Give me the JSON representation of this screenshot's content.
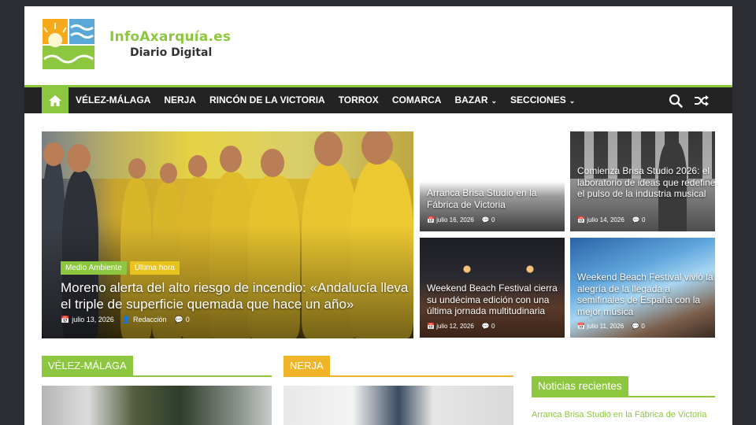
{
  "site": {
    "name": "InfoAxarquía.es",
    "tagline": "Diario Digital"
  },
  "colors": {
    "accent": "#8dc63f",
    "nav_bg": "#232323",
    "tag_yellow": "#e8c21d",
    "nerja": "#f0b429"
  },
  "nav": {
    "home_icon": "home-icon",
    "items": [
      {
        "label": "VÉLEZ-MÁLAGA"
      },
      {
        "label": "NERJA"
      },
      {
        "label": "RINCÓN DE LA VICTORIA"
      },
      {
        "label": "TORROX"
      },
      {
        "label": "COMARCA"
      },
      {
        "label": "BAZAR",
        "dropdown": true
      },
      {
        "label": "SECCIONES",
        "dropdown": true
      }
    ],
    "search_icon": "search-icon",
    "random_icon": "shuffle-icon"
  },
  "featured": {
    "main": {
      "tags": [
        "Medio Ambiente",
        "Última hora"
      ],
      "title": "Moreno alerta del alto riesgo de incendio: «Andalucía lleva el triple de superficie quemada que hace un año»",
      "date": "julio 13, 2026",
      "author": "Redacción",
      "comments": "0"
    },
    "side": [
      {
        "title": "Arranca Brisa Studio en la Fábrica de Victoria",
        "date": "julio 16, 2026",
        "comments": "0"
      },
      {
        "title": "Comienza Brisa Studio 2026: el laboratorio de ideas que redefine el pulso de la industria musical",
        "date": "julio 14, 2026",
        "comments": "0"
      },
      {
        "title": "Weekend Beach Festival cierra su undécima edición con una última jornada multitudinaria",
        "date": "julio 12, 2026",
        "comments": "0"
      },
      {
        "title": "Weekend Beach Festival vivió la alegría de la llegada a semifinales de España con la mejor música",
        "date": "julio 11, 2026",
        "comments": "0"
      }
    ]
  },
  "sections": {
    "velez": "VÉLEZ-MÁLAGA",
    "nerja": "NERJA",
    "recent": "Noticias recientes"
  },
  "recent": {
    "first": "Arranca Brisa Studio en la Fábrica de Victoria"
  }
}
